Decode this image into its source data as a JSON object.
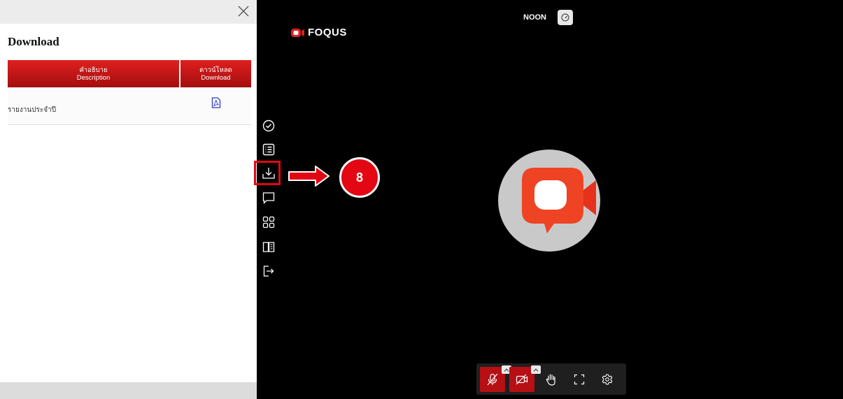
{
  "panel": {
    "title": "Download",
    "table": {
      "headers": [
        {
          "th": "คำอธิบาย",
          "en": "Description"
        },
        {
          "th": "ดาวน์โหลด",
          "en": "Download"
        }
      ],
      "rows": [
        {
          "description": "รายงานประจำปี",
          "file_icon": "pdf-icon"
        }
      ]
    }
  },
  "main": {
    "logo_text": "FOQUS",
    "username": "NOON",
    "annotation_step": "8"
  },
  "toolbar": {
    "icons": [
      "check-circle-icon",
      "list-icon",
      "download-icon",
      "chat-icon",
      "grid-icon",
      "book-icon",
      "exit-icon"
    ]
  },
  "controls": {
    "icons": [
      "mic-off-icon",
      "camera-off-icon",
      "raise-hand-icon",
      "fullscreen-icon",
      "settings-icon"
    ]
  },
  "colors": {
    "accent_red": "#e30613",
    "header_red": "#c41414",
    "dark_bg": "#000000",
    "control_red": "#b60f14"
  }
}
